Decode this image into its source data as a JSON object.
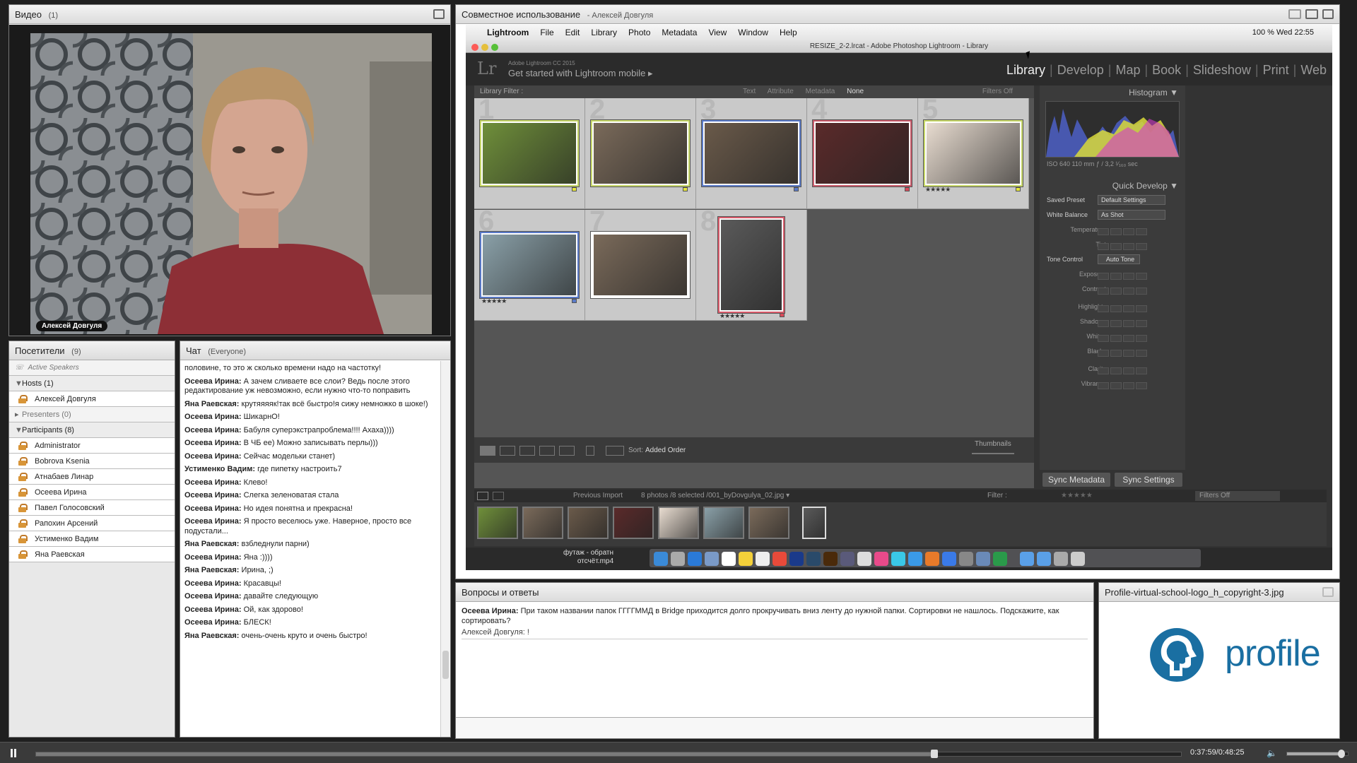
{
  "video": {
    "title": "Видео",
    "count": "(1)",
    "speaker_label": "Алексей Довгуля"
  },
  "attendees": {
    "title": "Посетители",
    "count": "(9)",
    "active_speakers": "Active Speakers",
    "hosts_label": "Hosts (1)",
    "hosts": [
      "Алексей Довгуля"
    ],
    "presenters_label": "Presenters (0)",
    "participants_label": "Participants (8)",
    "participants": [
      "Administrator",
      "Bobrova Ksenia",
      "Атнабаев Линар",
      "Осеева Ирина",
      "Павел Голосовский",
      "Рапохин Арсений",
      "Устименко Вадим",
      "Яна Раевская"
    ]
  },
  "chat": {
    "title": "Чат",
    "scope": "(Everyone)",
    "messages": [
      {
        "author": "",
        "text": "половине, то это ж сколько времени надо на частотку!"
      },
      {
        "author": "Осеева Ирина:",
        "text": "А зачем сливаете все слои? Ведь после этого редактирование уж невозможно, если нужно что-то поправить"
      },
      {
        "author": "Яна Раевская:",
        "text": "крутяяяяк!так всё быстро!я сижу немножко в шоке!)"
      },
      {
        "author": "Осеева Ирина:",
        "text": "ШикарнО!"
      },
      {
        "author": "Осеева Ирина:",
        "text": "Бабуля суперэкстрапроблема!!!! Ахаха))))"
      },
      {
        "author": "Осеева Ирина:",
        "text": "В ЧБ ее) Можно записывать перлы)))"
      },
      {
        "author": "Осеева Ирина:",
        "text": "Сейчас модельки станет)"
      },
      {
        "author": "Устименко Вадим:",
        "text": "где пипетку настроить7"
      },
      {
        "author": "Осеева Ирина:",
        "text": "Клево!"
      },
      {
        "author": "Осеева Ирина:",
        "text": "Слегка зеленоватая стала"
      },
      {
        "author": "Осеева Ирина:",
        "text": "Но идея понятна и прекрасна!"
      },
      {
        "author": "Осеева Ирина:",
        "text": "Я просто веселюсь уже. Наверное, просто все подустали..."
      },
      {
        "author": "Яна Раевская:",
        "text": "взбледнули парни)"
      },
      {
        "author": "Осеева Ирина:",
        "text": "Яна :))))"
      },
      {
        "author": "Яна Раевская:",
        "text": "Ирина, ;)"
      },
      {
        "author": "Осеева Ирина:",
        "text": "Красавцы!"
      },
      {
        "author": "Осеева Ирина:",
        "text": "давайте следующую"
      },
      {
        "author": "Осеева Ирина:",
        "text": "Ой, как здорово!"
      },
      {
        "author": "Осеева Ирина:",
        "text": "БЛЕСК!"
      },
      {
        "author": "Яна Раевская:",
        "text": "очень-очень круто и очень быстро!"
      }
    ]
  },
  "share": {
    "title": "Совместное использование",
    "presenter": "- Алексей Довгуля",
    "mac_menu": [
      "Lightroom",
      "File",
      "Edit",
      "Library",
      "Photo",
      "Metadata",
      "View",
      "Window",
      "Help"
    ],
    "mac_status": "100 %   Wed 22:55",
    "window_title": "RESIZE_2-2.lrcat - Adobe Photoshop Lightroom - Library",
    "lr_version": "Adobe Lightroom CC 2015",
    "lr_mobile": "Get started with Lightroom mobile  ▸",
    "modules": [
      "Library",
      "Develop",
      "Map",
      "Book",
      "Slideshow",
      "Print",
      "Web"
    ],
    "library_filter": "Library Filter :",
    "filter_opts": [
      "Text",
      "Attribute",
      "Metadata",
      "None"
    ],
    "filters_off": "Filters Off",
    "grid_numbers": [
      "1",
      "2",
      "3",
      "4",
      "5",
      "6",
      "7",
      "8"
    ],
    "stars": "★★★★★",
    "sort_label": "Sort:",
    "sort_value": "Added Order",
    "thumbnails_label": "Thumbnails",
    "histogram_label": "Histogram",
    "hist_info": "ISO 640     110 mm     ƒ / 3,2     ¹⁄₁₆₀ sec",
    "quick_develop": "Quick Develop",
    "saved_preset": "Saved Preset",
    "saved_preset_value": "Default Settings",
    "white_balance": "White Balance",
    "white_balance_value": "As Shot",
    "temperature": "Temperature",
    "tint": "Tint",
    "tone_control": "Tone Control",
    "auto_tone": "Auto Tone",
    "tone_rows": [
      "Exposure",
      "Contrast",
      "Highlights",
      "Shadows",
      "Whites",
      "Blacks",
      "Clarity",
      "Vibrance"
    ],
    "sync_metadata": "Sync Metadata",
    "sync_settings": "Sync Settings",
    "film_prev_import": "Previous Import",
    "film_count": "8 photos /8 selected /001_byDovgulya_02.jpg ▾",
    "film_filter": "Filter :",
    "film_filters_off": "Filters Off",
    "dock_file": "футаж - обратн\nотсчёт.mp4"
  },
  "qa": {
    "title": "Вопросы и ответы",
    "question_author": "Осеева Ирина:",
    "question": "При таком названии папок ГГГГММД в Bridge приходится долго прокручивать вниз ленту до нужной папки. Сортировки не нашлось. Подскажите, как сортировать?",
    "answer": "Алексей Довгуля: !"
  },
  "logo_pod": {
    "title": "Profile-virtual-school-logo_h_copyright-3.jpg"
  },
  "player": {
    "time": "0:37:59/0:48:25",
    "progress": 0.7845,
    "volume": 0.9
  }
}
